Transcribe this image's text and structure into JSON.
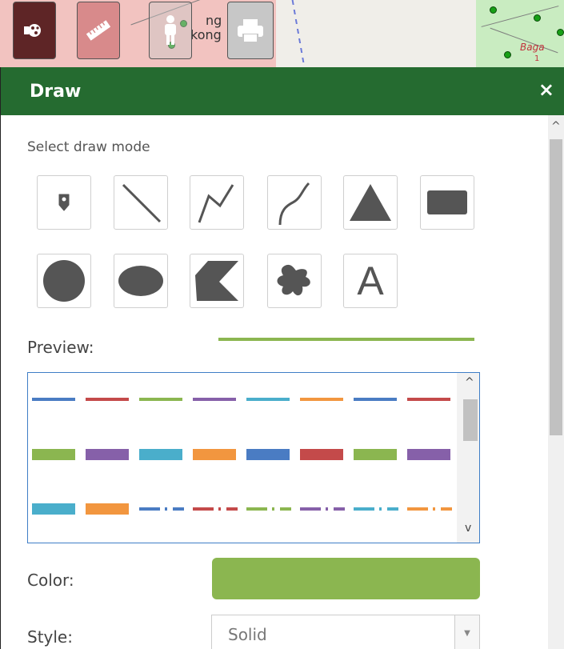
{
  "map": {
    "labels": [
      "ng",
      "kong"
    ],
    "place": "Baga",
    "place_number": "1"
  },
  "toolbar": {
    "tools": [
      "draw-icon",
      "ruler-icon",
      "person-icon",
      "print-icon"
    ]
  },
  "panel": {
    "title": "Draw",
    "close": "×"
  },
  "draw": {
    "select_mode_label": "Select draw mode",
    "modes": [
      "point",
      "line",
      "polyline",
      "freehand-line",
      "triangle",
      "rectangle",
      "circle",
      "ellipse",
      "polygon",
      "freehand-polygon",
      "text"
    ],
    "text_glyph": "A",
    "preview_label": "Preview:",
    "preview_color": "#8bb650",
    "style_list": {
      "up": "^",
      "down": "v",
      "colors": [
        "#4a7cc3",
        "#c44a4a",
        "#8bb650",
        "#8660a9",
        "#4aaecb",
        "#f2963f"
      ]
    },
    "color_label": "Color:",
    "color_value": "#8bb650",
    "style_label": "Style:",
    "style_value": "Solid"
  }
}
